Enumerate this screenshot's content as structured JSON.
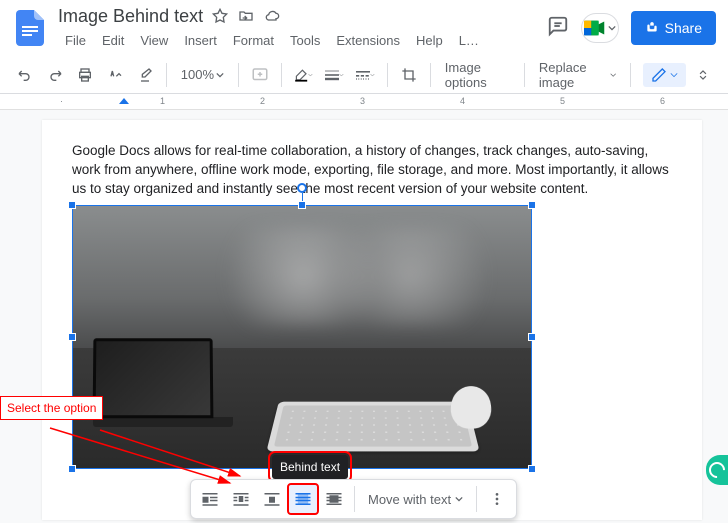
{
  "header": {
    "title": "Image Behind text",
    "menu": [
      "File",
      "Edit",
      "View",
      "Insert",
      "Format",
      "Tools",
      "Extensions",
      "Help",
      "L…"
    ],
    "share_label": "Share"
  },
  "toolbar": {
    "zoom": "100%",
    "image_options": "Image options",
    "replace_image": "Replace image"
  },
  "ruler": {
    "marks": [
      "1",
      "2",
      "3",
      "4",
      "5",
      "6"
    ]
  },
  "document": {
    "body_text": "Google Docs allows for real-time collaboration, a history of changes, track changes, auto-saving, work from anywhere, offline work mode, exporting, file storage, and more. Most importantly, it allows us to stay organized and instantly see the most recent version of your website content."
  },
  "float_toolbar": {
    "tooltip": "Behind text",
    "move_mode": "Move with text"
  },
  "annotation": {
    "label": "Select the option"
  }
}
